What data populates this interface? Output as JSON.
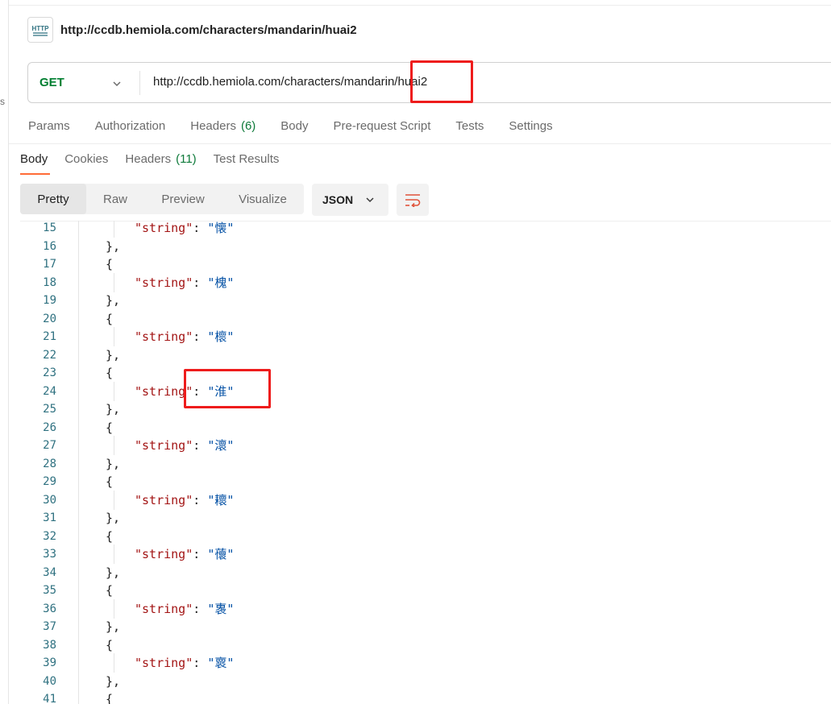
{
  "sidebar_fragment": "s",
  "request": {
    "title": "http://ccdb.hemiola.com/characters/mandarin/huai2",
    "method": "GET",
    "url": "http://ccdb.hemiola.com/characters/mandarin/huai2"
  },
  "request_tabs": {
    "params": "Params",
    "authorization": "Authorization",
    "headers": "Headers",
    "headers_count": "(6)",
    "body": "Body",
    "prerequest": "Pre-request Script",
    "tests": "Tests",
    "settings": "Settings"
  },
  "response_tabs": {
    "body": "Body",
    "cookies": "Cookies",
    "headers": "Headers",
    "headers_count": "(11)",
    "test_results": "Test Results"
  },
  "view_modes": [
    "Pretty",
    "Raw",
    "Preview",
    "Visualize"
  ],
  "format": "JSON",
  "colors": {
    "accent_orange": "#ff6c37",
    "method_green": "#007f31",
    "highlight_red": "#ee1c1c"
  },
  "code_lines": [
    {
      "n": "15",
      "key": "string",
      "value": "懐"
    },
    {
      "n": "16",
      "text": "},"
    },
    {
      "n": "17",
      "text": "{"
    },
    {
      "n": "18",
      "key": "string",
      "value": "槐"
    },
    {
      "n": "19",
      "text": "},"
    },
    {
      "n": "20",
      "text": "{"
    },
    {
      "n": "21",
      "key": "string",
      "value": "櫰"
    },
    {
      "n": "22",
      "text": "},"
    },
    {
      "n": "23",
      "text": "{"
    },
    {
      "n": "24",
      "key": "string",
      "value": "淮"
    },
    {
      "n": "25",
      "text": "},"
    },
    {
      "n": "26",
      "text": "{"
    },
    {
      "n": "27",
      "key": "string",
      "value": "瀤"
    },
    {
      "n": "28",
      "text": "},"
    },
    {
      "n": "29",
      "text": "{"
    },
    {
      "n": "30",
      "key": "string",
      "value": "耲"
    },
    {
      "n": "31",
      "text": "},"
    },
    {
      "n": "32",
      "text": "{"
    },
    {
      "n": "33",
      "key": "string",
      "value": "蘹"
    },
    {
      "n": "34",
      "text": "},"
    },
    {
      "n": "35",
      "text": "{"
    },
    {
      "n": "36",
      "key": "string",
      "value": "褢"
    },
    {
      "n": "37",
      "text": "},"
    },
    {
      "n": "38",
      "text": "{"
    },
    {
      "n": "39",
      "key": "string",
      "value": "褱"
    },
    {
      "n": "40",
      "text": "},"
    },
    {
      "n": "41",
      "text": "{"
    }
  ]
}
